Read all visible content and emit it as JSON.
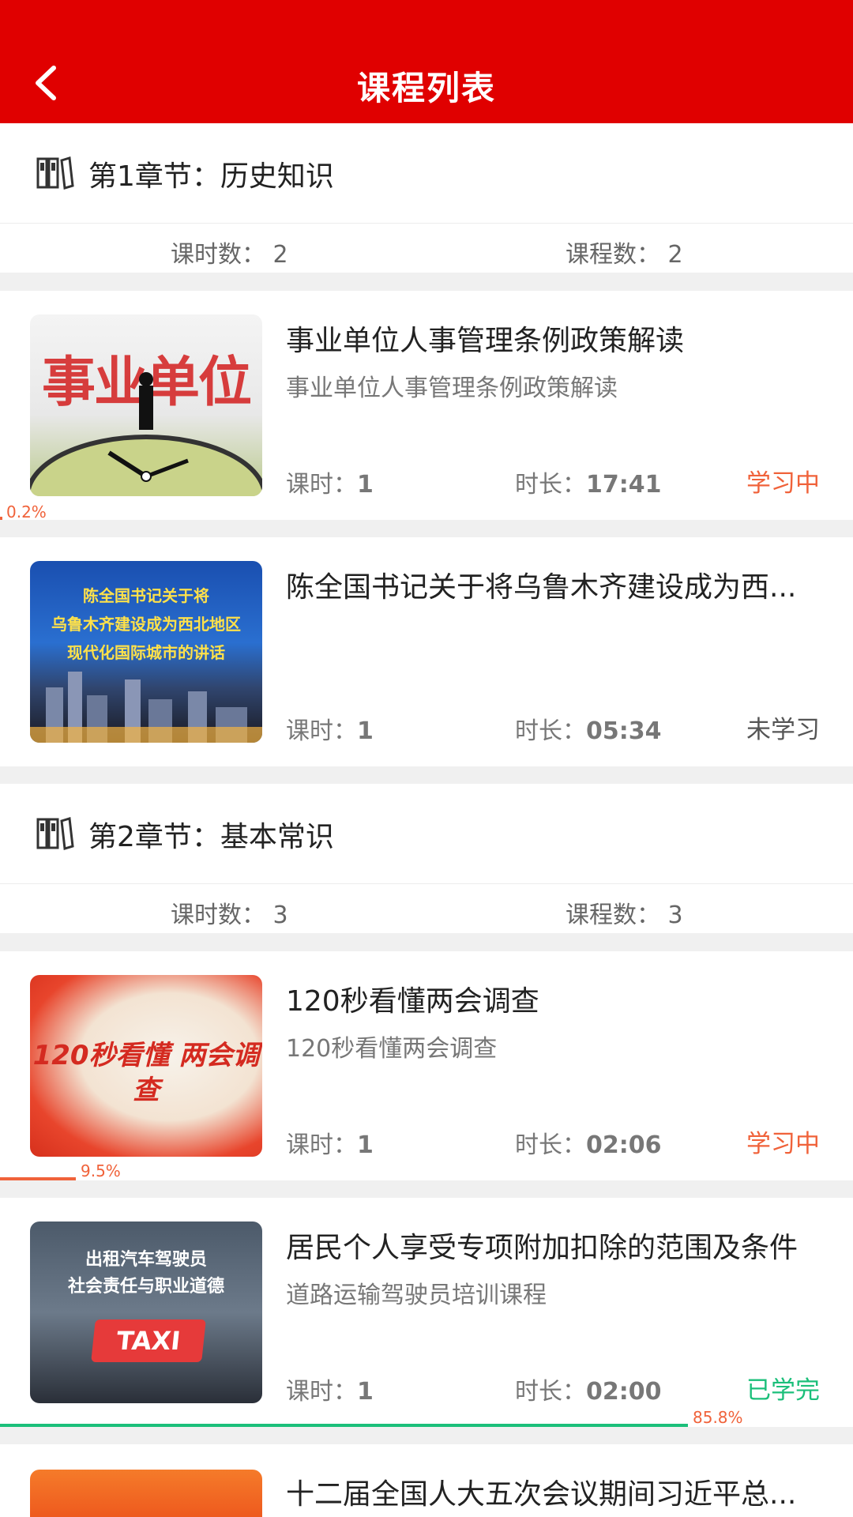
{
  "header": {
    "title": "课程列表",
    "back_icon": "chevron-left-icon"
  },
  "colors": {
    "brand_red": "#e00000",
    "learning": "#f0623a",
    "done": "#1bbf7a"
  },
  "chapters": [
    {
      "title": "第1章节：历史知识",
      "hours": "课时数：  2",
      "courses_count": "课程数：  2",
      "courses": [
        {
          "title": "事业单位人事管理条例政策解读",
          "subtitle": "事业单位人事管理条例政策解读",
          "lessons_label": "课时：",
          "lessons": "1",
          "duration_label": "时长：",
          "duration": "17:41",
          "status": "学习中",
          "progress": 0.002,
          "progress_label": "0.2%",
          "thumb_text": "事业单位"
        },
        {
          "title": "陈全国书记关于将乌鲁木齐建设成为西...",
          "subtitle": "",
          "lessons_label": "课时：",
          "lessons": "1",
          "duration_label": "时长：",
          "duration": "05:34",
          "status": "未学习",
          "thumb_lines": [
            "陈全国书记关于将",
            "乌鲁木齐建设成为西北地区",
            "现代化国际城市的讲话"
          ]
        }
      ]
    },
    {
      "title": "第2章节：基本常识",
      "hours": "课时数：  3",
      "courses_count": "课程数：  3",
      "courses": [
        {
          "title": "120秒看懂两会调查",
          "subtitle": "120秒看懂两会调查",
          "lessons_label": "课时：",
          "lessons": "1",
          "duration_label": "时长：",
          "duration": "02:06",
          "status": "学习中",
          "progress": 0.095,
          "progress_label": "9.5%",
          "thumb_text": "120秒看懂 两会调查"
        },
        {
          "title": "居民个人享受专项附加扣除的范围及条件",
          "subtitle": "道路运输驾驶员培训课程",
          "lessons_label": "课时：",
          "lessons": "1",
          "duration_label": "时长：",
          "duration": "02:00",
          "status": "已学完",
          "progress": 0.858,
          "progress_label": "85.8%",
          "thumb_lines": [
            "出租汽车驾驶员",
            "社会责任与职业道德",
            "TAXI"
          ]
        },
        {
          "title": "十二届全国人大五次会议期间习近平总..."
        }
      ]
    }
  ]
}
